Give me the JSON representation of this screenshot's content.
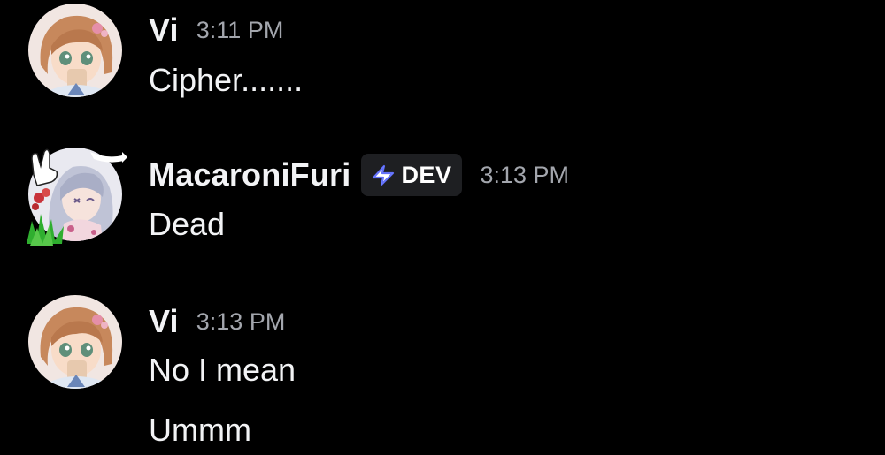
{
  "messages": [
    {
      "username": "Vi",
      "timestamp": "3:11 PM",
      "lines": [
        "Cipher......."
      ],
      "avatar_icon": "anime-girl-avatar-icon"
    },
    {
      "username": "MacaroniFuri",
      "tag": "DEV",
      "tag_icon": "lightning-bolt-icon",
      "timestamp": "3:13 PM",
      "lines": [
        "Dead"
      ],
      "avatar_icon": "anime-girl-avatar-icon",
      "avatar_decoration": "hand-and-grass-decoration"
    },
    {
      "username": "Vi",
      "timestamp": "3:13 PM",
      "lines": [
        "No I mean",
        "Ummm"
      ],
      "avatar_icon": "anime-girl-avatar-icon"
    }
  ],
  "colors": {
    "background": "#000000",
    "username": "#f2f3f5",
    "timestamp": "#a3a6ad",
    "tag_background": "#1e1f22",
    "tag_icon": "#5865f2"
  }
}
